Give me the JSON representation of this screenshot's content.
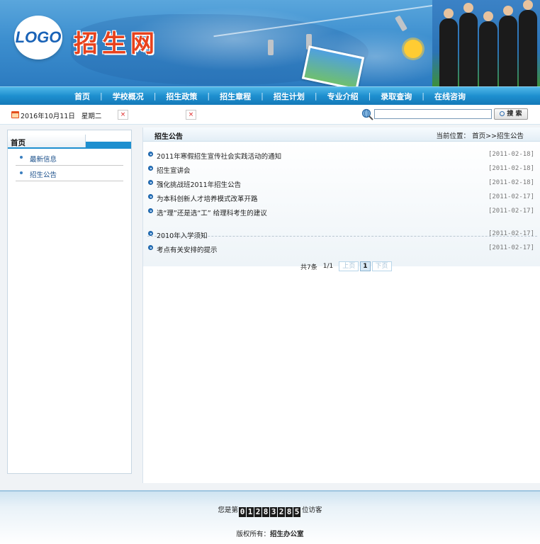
{
  "header": {
    "logo_text": "LOGO",
    "site_title": "招生网"
  },
  "nav": {
    "items": [
      {
        "label": "首页"
      },
      {
        "label": "学校概况"
      },
      {
        "label": "招生政策"
      },
      {
        "label": "招生章程"
      },
      {
        "label": "招生计划"
      },
      {
        "label": "专业介绍"
      },
      {
        "label": "录取查询"
      },
      {
        "label": "在线咨询"
      }
    ],
    "separator": "|"
  },
  "infobar": {
    "date": "2016年10月11日",
    "weekday": "星期二",
    "broken_image_glyph": "×",
    "search_placeholder": "",
    "search_button": "搜 索"
  },
  "sidebar": {
    "title": "首页",
    "items": [
      {
        "label": "最新信息"
      },
      {
        "label": "招生公告"
      }
    ]
  },
  "content": {
    "title": "招生公告",
    "breadcrumb_prefix": "当前位置：",
    "breadcrumb": "首页>>招生公告",
    "articles_group1": [
      {
        "title": "2011年寒假招生宣传社会实践活动的通知",
        "date": "[2011-02-18]"
      },
      {
        "title": "招生宣讲会",
        "date": "[2011-02-18]"
      },
      {
        "title": "强化挑战班2011年招生公告",
        "date": "[2011-02-18]"
      },
      {
        "title": "为本科创新人才培养模式改革开路",
        "date": "[2011-02-17]"
      },
      {
        "title": "选“理”还是选“工” 给理科考生的建议",
        "date": "[2011-02-17]"
      }
    ],
    "articles_group2": [
      {
        "title": "2010年入学须知",
        "date": "[2011-02-17]"
      },
      {
        "title": "考点有关安排的提示",
        "date": "[2011-02-17]"
      }
    ],
    "pager": {
      "total": "共7条",
      "page": "1/1",
      "prev": "上页",
      "current": "1",
      "next": "下页"
    }
  },
  "footer": {
    "visitor_prefix": "您是第",
    "visitor_digits": [
      "0",
      "1",
      "2",
      "8",
      "3",
      "2",
      "8",
      "5"
    ],
    "visitor_suffix": "位访客",
    "copyright_prefix": "版权所有：",
    "copyright_owner": "招生办公室"
  },
  "colors": {
    "nav_blue": "#1e8fcf",
    "title_red": "#e8421d",
    "link_blue": "#1a4f8a"
  }
}
